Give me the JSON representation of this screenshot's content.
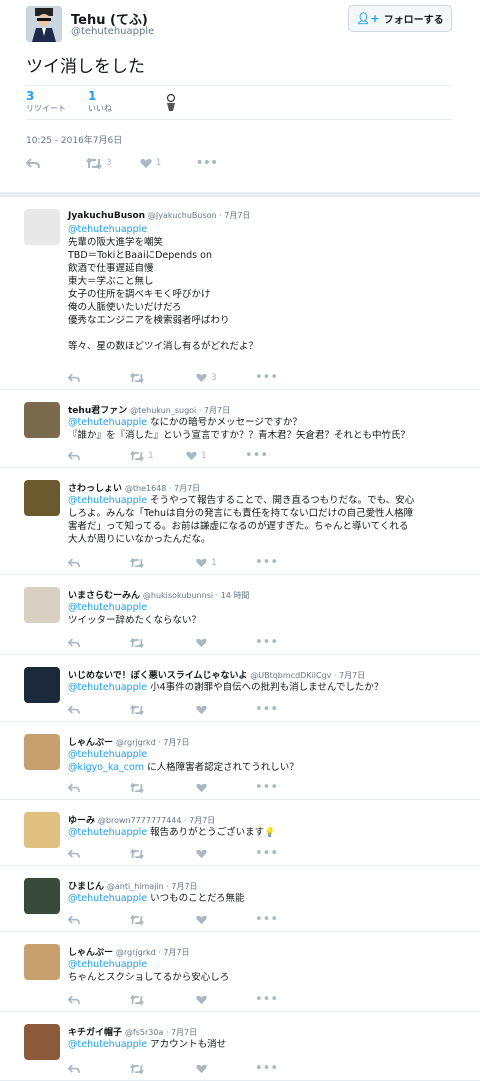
{
  "tweet": {
    "author_name": "Tehu (てふ)",
    "author_handle": "@tehutehuapple",
    "follow_label": "フォローする",
    "text": "ツイ消しをした",
    "retweets": "3",
    "retweets_label": "リツイート",
    "likes": "1",
    "likes_label": "いいね",
    "timestamp": "10:25 - 2016年7月6日",
    "action_retweets": "3",
    "action_likes": "1"
  },
  "replies": [
    {
      "name": "JyakuchuBuson",
      "handle": "@JyakuchuBuson · 7月7日",
      "mention": "@tehutehuapple",
      "lines": [
        "先輩の阪大進学を嘲笑",
        "TBD＝TokiとBaaiにDepends on",
        "飲酒で仕事遅延自慢",
        "東大＝学ぶこと無し",
        "女子の住所を調べキモく呼びかけ",
        "俺の人脈使いたいだけだろ",
        "優秀なエンジニアを検索弱者呼ばわり",
        "",
        "等々、星の数ほどツイ消し有るがどれだよ？"
      ],
      "retweets": "",
      "likes": "3",
      "avatar_color": "#e8e8e8"
    },
    {
      "name": "tehu君ファン",
      "handle": "@tehukun_sugoi · 7月7日",
      "mention": "@tehutehuapple",
      "text1": "なにかの暗号かメッセージですか？",
      "lines": [
        "『誰か』を『消した』という宣言ですか？？青木君？矢倉君？それとも中竹氏？"
      ],
      "retweets": "1",
      "likes": "1",
      "avatar_color": "#7a6a4e"
    },
    {
      "name": "さわっしょい",
      "handle": "@the1648 · 7月7日",
      "mention": "@tehutehuapple",
      "text1": "そうやって報告することで、開き直るつもりだな。でも、安心",
      "lines": [
        "しろよ。みんな「Tehuは自分の発言にも責任を持てない口だけの自己愛性人格障",
        "害者だ」って知ってる。お前は謙虚になるのが遅すぎた。ちゃんと導いてくれる",
        "大人が周りにいなかったんだな。"
      ],
      "retweets": "",
      "likes": "1",
      "avatar_color": "#6b5a2e"
    },
    {
      "name": "いまさらむーみん",
      "handle": "@hukisokubunnsi · 14 時間",
      "mention": "@tehutehuapple",
      "lines": [
        "ツイッター辞めたくならない？"
      ],
      "retweets": "",
      "likes": "",
      "avatar_color": "#d8d0c0"
    },
    {
      "name": "いじめないで！ぼく悪いスライムじゃないよ",
      "handle": "@UBtqbmcdDKilCgv · 7月7日",
      "mention": "@tehutehuapple",
      "text1": "小4事件の謝罪や自伝への批判も消しませんでしたか？",
      "lines": [],
      "retweets": "",
      "likes": "",
      "avatar_color": "#1a2a3a"
    },
    {
      "name": "しゃんぷー",
      "handle": "@rgrjgrkd · 7月7日",
      "mention": "@tehutehuapple",
      "mention2": "@kigyo_ka_com",
      "text2": "に人格障害者認定されてうれしい？",
      "lines": [],
      "retweets": "",
      "likes": "",
      "avatar_color": "#c8a070"
    },
    {
      "name": "ゆーみ",
      "handle": "@brown7777777444 · 7月7日",
      "mention": "@tehutehuapple",
      "text1": "報告ありがとうございます",
      "lines": [],
      "retweets": "",
      "likes": "",
      "avatar_color": "#e0c080"
    },
    {
      "name": "ひまじん",
      "handle": "@anti_himajin · 7月7日",
      "mention": "@tehutehuapple",
      "text1": "いつものことだろ無能",
      "lines": [],
      "retweets": "",
      "likes": "",
      "avatar_color": "#3a4a3a"
    },
    {
      "name": "しゃんぷー",
      "handle": "@rgrjgrkd · 7月7日",
      "mention": "@tehutehuapple",
      "lines": [
        "ちゃんとスクショしてるから安心しろ"
      ],
      "retweets": "",
      "likes": "",
      "avatar_color": "#c8a070"
    },
    {
      "name": "キチガイ帽子",
      "handle": "@fs5r30a · 7月7日",
      "mention": "@tehutehuapple",
      "text1": "アカウントも消せ",
      "lines": [],
      "retweets": "",
      "likes": "",
      "avatar_color": "#8a5a3a"
    }
  ]
}
